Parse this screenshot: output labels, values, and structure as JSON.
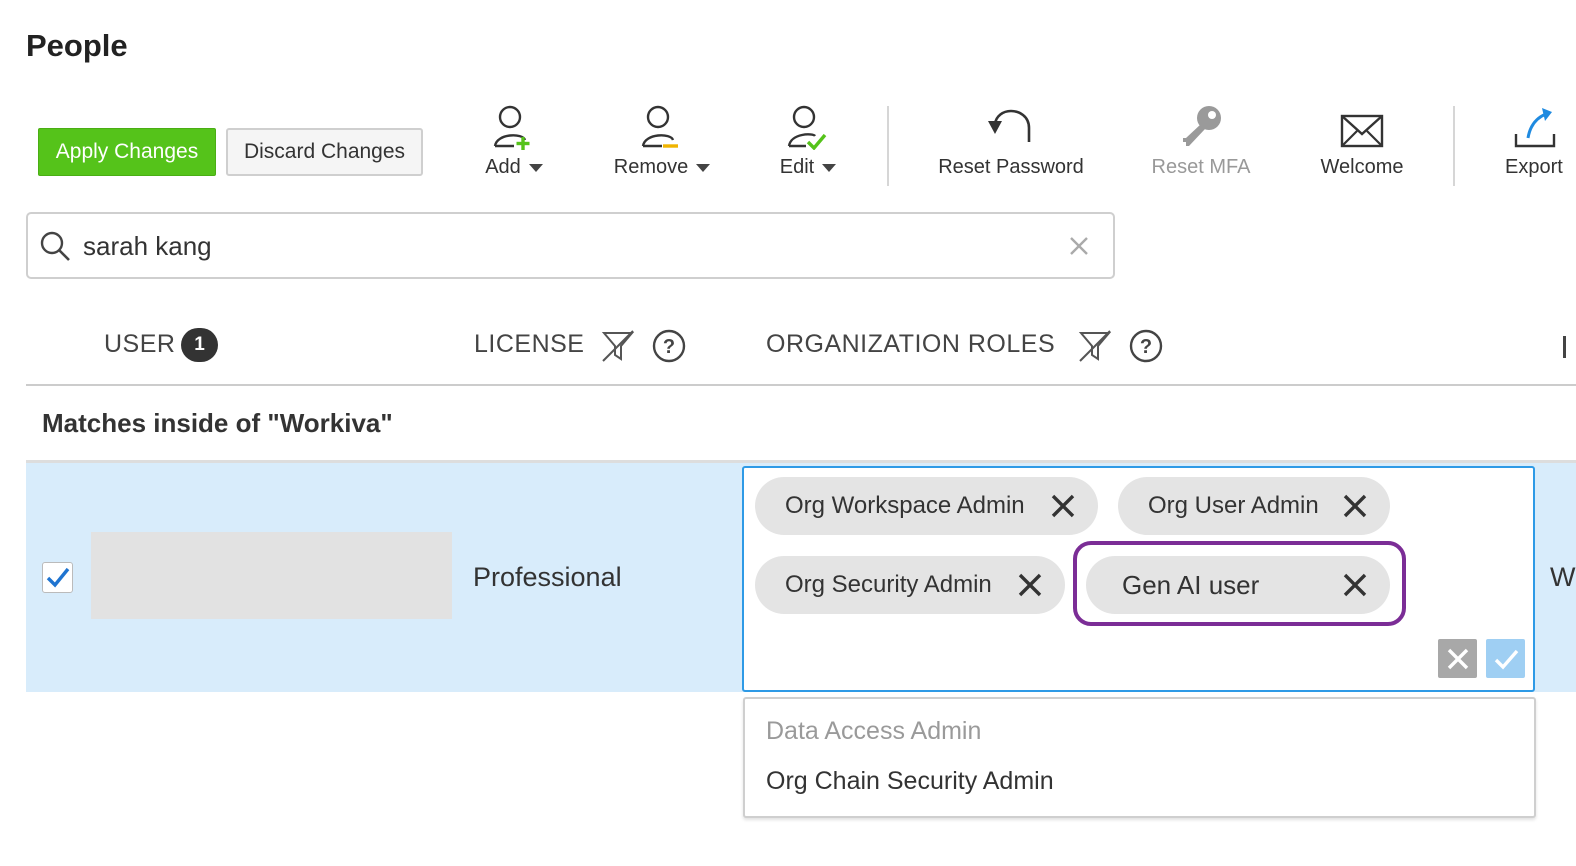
{
  "page": {
    "title": "People"
  },
  "actions": {
    "apply_label": "Apply Changes",
    "discard_label": "Discard Changes"
  },
  "toolbar": {
    "add_label": "Add",
    "remove_label": "Remove",
    "edit_label": "Edit",
    "reset_password_label": "Reset Password",
    "reset_mfa_label": "Reset MFA",
    "welcome_label": "Welcome",
    "export_label": "Export"
  },
  "search": {
    "value": "sarah kang"
  },
  "columns": {
    "user": "USER",
    "user_count": "1",
    "license": "LICENSE",
    "org_roles": "ORGANIZATION ROLES"
  },
  "group": {
    "title": "Matches inside of \"Workiva\""
  },
  "row": {
    "selected": true,
    "license": "Professional",
    "cut_off_text": "W",
    "roles": [
      "Org Workspace Admin",
      "Org User Admin",
      "Org Security Admin",
      "Gen AI user"
    ]
  },
  "dropdown": {
    "options": [
      {
        "label": "Data Access Admin",
        "disabled": true
      },
      {
        "label": "Org Chain Security Admin",
        "disabled": false
      }
    ]
  },
  "colors": {
    "apply_green": "#55c31a",
    "row_selected": "#d8ecfb",
    "editor_border": "#2e9ae6",
    "highlight_purple": "#7b2d96",
    "add_plus": "#55c31a",
    "remove_minus": "#f0b400",
    "edit_check": "#55c31a",
    "export_arrow": "#1f8ae0"
  }
}
